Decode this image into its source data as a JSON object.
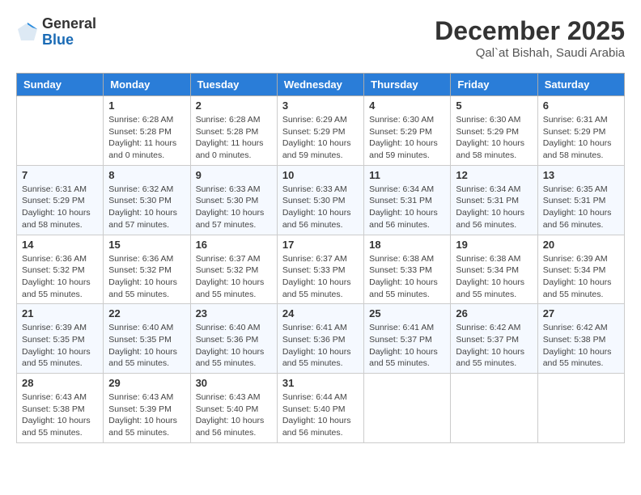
{
  "logo": {
    "general": "General",
    "blue": "Blue"
  },
  "title": "December 2025",
  "location": "Qal`at Bishah, Saudi Arabia",
  "weekdays": [
    "Sunday",
    "Monday",
    "Tuesday",
    "Wednesday",
    "Thursday",
    "Friday",
    "Saturday"
  ],
  "weeks": [
    [
      {
        "day": "",
        "info": ""
      },
      {
        "day": "1",
        "info": "Sunrise: 6:28 AM\nSunset: 5:28 PM\nDaylight: 11 hours\nand 0 minutes."
      },
      {
        "day": "2",
        "info": "Sunrise: 6:28 AM\nSunset: 5:28 PM\nDaylight: 11 hours\nand 0 minutes."
      },
      {
        "day": "3",
        "info": "Sunrise: 6:29 AM\nSunset: 5:29 PM\nDaylight: 10 hours\nand 59 minutes."
      },
      {
        "day": "4",
        "info": "Sunrise: 6:30 AM\nSunset: 5:29 PM\nDaylight: 10 hours\nand 59 minutes."
      },
      {
        "day": "5",
        "info": "Sunrise: 6:30 AM\nSunset: 5:29 PM\nDaylight: 10 hours\nand 58 minutes."
      },
      {
        "day": "6",
        "info": "Sunrise: 6:31 AM\nSunset: 5:29 PM\nDaylight: 10 hours\nand 58 minutes."
      }
    ],
    [
      {
        "day": "7",
        "info": "Sunrise: 6:31 AM\nSunset: 5:29 PM\nDaylight: 10 hours\nand 58 minutes."
      },
      {
        "day": "8",
        "info": "Sunrise: 6:32 AM\nSunset: 5:30 PM\nDaylight: 10 hours\nand 57 minutes."
      },
      {
        "day": "9",
        "info": "Sunrise: 6:33 AM\nSunset: 5:30 PM\nDaylight: 10 hours\nand 57 minutes."
      },
      {
        "day": "10",
        "info": "Sunrise: 6:33 AM\nSunset: 5:30 PM\nDaylight: 10 hours\nand 56 minutes."
      },
      {
        "day": "11",
        "info": "Sunrise: 6:34 AM\nSunset: 5:31 PM\nDaylight: 10 hours\nand 56 minutes."
      },
      {
        "day": "12",
        "info": "Sunrise: 6:34 AM\nSunset: 5:31 PM\nDaylight: 10 hours\nand 56 minutes."
      },
      {
        "day": "13",
        "info": "Sunrise: 6:35 AM\nSunset: 5:31 PM\nDaylight: 10 hours\nand 56 minutes."
      }
    ],
    [
      {
        "day": "14",
        "info": "Sunrise: 6:36 AM\nSunset: 5:32 PM\nDaylight: 10 hours\nand 55 minutes."
      },
      {
        "day": "15",
        "info": "Sunrise: 6:36 AM\nSunset: 5:32 PM\nDaylight: 10 hours\nand 55 minutes."
      },
      {
        "day": "16",
        "info": "Sunrise: 6:37 AM\nSunset: 5:32 PM\nDaylight: 10 hours\nand 55 minutes."
      },
      {
        "day": "17",
        "info": "Sunrise: 6:37 AM\nSunset: 5:33 PM\nDaylight: 10 hours\nand 55 minutes."
      },
      {
        "day": "18",
        "info": "Sunrise: 6:38 AM\nSunset: 5:33 PM\nDaylight: 10 hours\nand 55 minutes."
      },
      {
        "day": "19",
        "info": "Sunrise: 6:38 AM\nSunset: 5:34 PM\nDaylight: 10 hours\nand 55 minutes."
      },
      {
        "day": "20",
        "info": "Sunrise: 6:39 AM\nSunset: 5:34 PM\nDaylight: 10 hours\nand 55 minutes."
      }
    ],
    [
      {
        "day": "21",
        "info": "Sunrise: 6:39 AM\nSunset: 5:35 PM\nDaylight: 10 hours\nand 55 minutes."
      },
      {
        "day": "22",
        "info": "Sunrise: 6:40 AM\nSunset: 5:35 PM\nDaylight: 10 hours\nand 55 minutes."
      },
      {
        "day": "23",
        "info": "Sunrise: 6:40 AM\nSunset: 5:36 PM\nDaylight: 10 hours\nand 55 minutes."
      },
      {
        "day": "24",
        "info": "Sunrise: 6:41 AM\nSunset: 5:36 PM\nDaylight: 10 hours\nand 55 minutes."
      },
      {
        "day": "25",
        "info": "Sunrise: 6:41 AM\nSunset: 5:37 PM\nDaylight: 10 hours\nand 55 minutes."
      },
      {
        "day": "26",
        "info": "Sunrise: 6:42 AM\nSunset: 5:37 PM\nDaylight: 10 hours\nand 55 minutes."
      },
      {
        "day": "27",
        "info": "Sunrise: 6:42 AM\nSunset: 5:38 PM\nDaylight: 10 hours\nand 55 minutes."
      }
    ],
    [
      {
        "day": "28",
        "info": "Sunrise: 6:43 AM\nSunset: 5:38 PM\nDaylight: 10 hours\nand 55 minutes."
      },
      {
        "day": "29",
        "info": "Sunrise: 6:43 AM\nSunset: 5:39 PM\nDaylight: 10 hours\nand 55 minutes."
      },
      {
        "day": "30",
        "info": "Sunrise: 6:43 AM\nSunset: 5:40 PM\nDaylight: 10 hours\nand 56 minutes."
      },
      {
        "day": "31",
        "info": "Sunrise: 6:44 AM\nSunset: 5:40 PM\nDaylight: 10 hours\nand 56 minutes."
      },
      {
        "day": "",
        "info": ""
      },
      {
        "day": "",
        "info": ""
      },
      {
        "day": "",
        "info": ""
      }
    ]
  ]
}
